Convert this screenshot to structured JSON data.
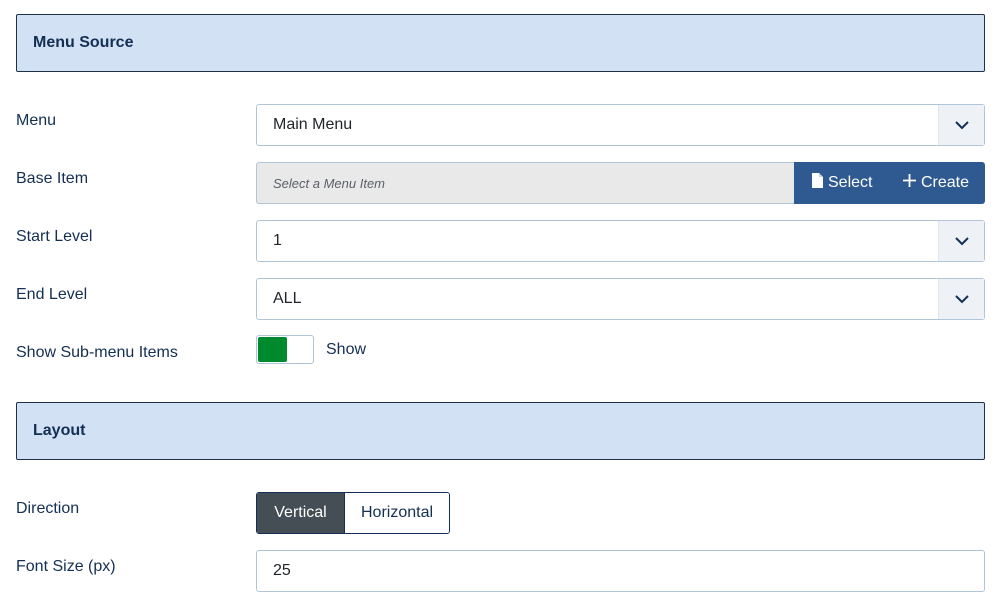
{
  "menu_source": {
    "title": "Menu Source"
  },
  "menu": {
    "label": "Menu",
    "value": "Main Menu"
  },
  "base_item": {
    "label": "Base Item",
    "placeholder": "Select a Menu Item",
    "select_label": "Select",
    "create_label": "Create"
  },
  "start_level": {
    "label": "Start Level",
    "value": "1"
  },
  "end_level": {
    "label": "End Level",
    "value": "ALL"
  },
  "show_submenu": {
    "label": "Show Sub-menu Items",
    "state_label": "Show",
    "on": true
  },
  "layout": {
    "title": "Layout"
  },
  "direction": {
    "label": "Direction",
    "options": [
      "Vertical",
      "Horizontal"
    ],
    "selected": "Vertical"
  },
  "font_size": {
    "label": "Font Size (px)",
    "value": "25"
  },
  "colors": {
    "header_bg": "#d3e1f4",
    "primary": "#2f5a91",
    "toggle_on": "#008a2e",
    "active_option": "#454d55"
  },
  "icons": [
    "chevron-down-icon",
    "file-icon",
    "plus-icon"
  ]
}
